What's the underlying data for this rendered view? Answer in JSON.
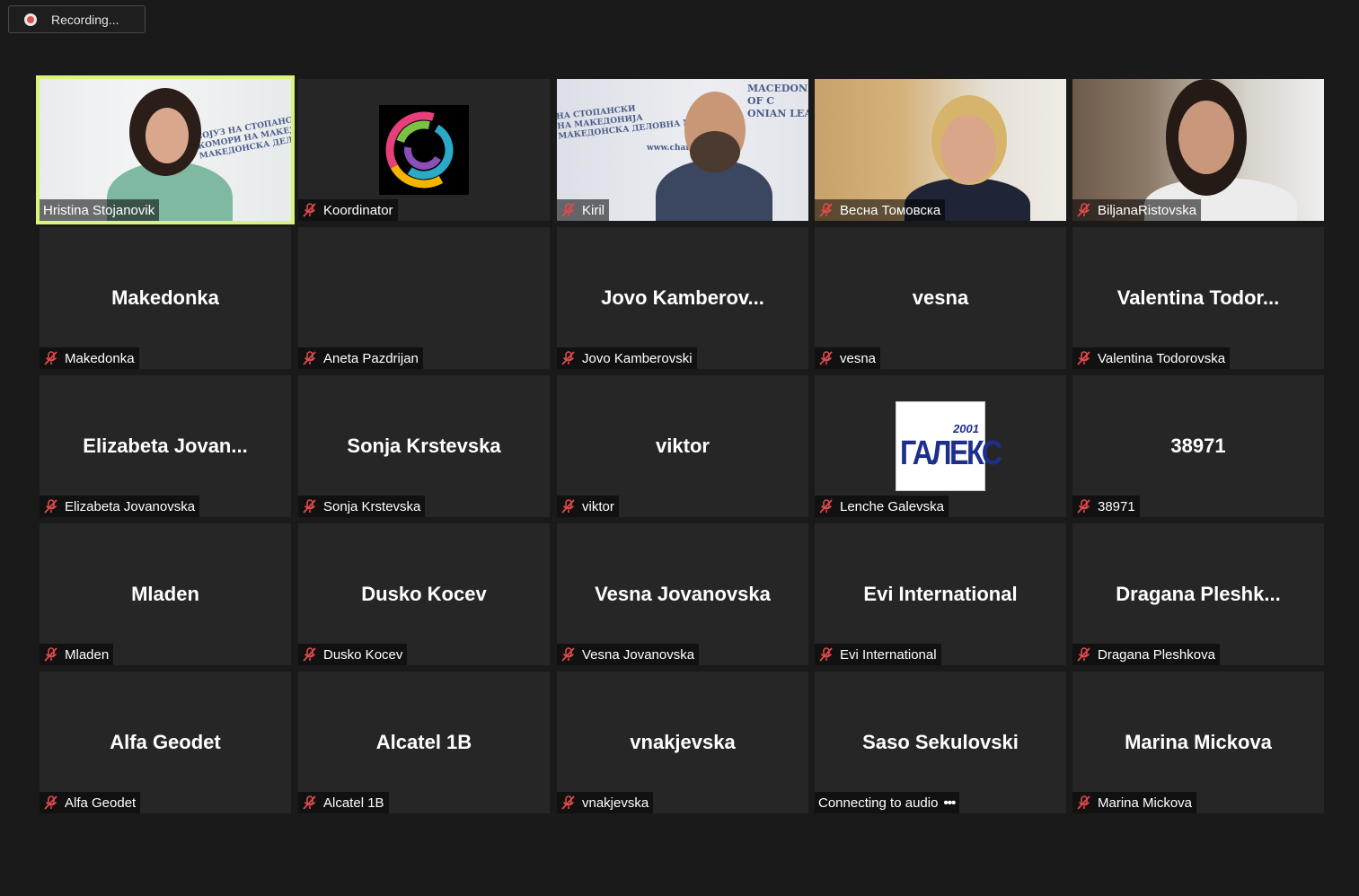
{
  "recording": {
    "label": "Recording..."
  },
  "participants": [
    {
      "label": "Hristina Stojanovik",
      "center": "",
      "muted": false,
      "video": "hristina",
      "active": true
    },
    {
      "label": "Koordinator",
      "center": "",
      "muted": true,
      "video": "logo"
    },
    {
      "label": "Kiril",
      "center": "",
      "muted": true,
      "video": "kiril"
    },
    {
      "label": "Весна Томовска",
      "center": "",
      "muted": true,
      "video": "vesna"
    },
    {
      "label": "BiljanaRistovska",
      "center": "",
      "muted": true,
      "video": "biljana"
    },
    {
      "label": "Makedonka",
      "center": "Makedonka",
      "muted": true
    },
    {
      "label": "Aneta Pazdrijan",
      "center": "",
      "muted": true
    },
    {
      "label": "Jovo Kamberovski",
      "center": "Jovo  Kamberov...",
      "muted": true
    },
    {
      "label": "vesna",
      "center": "vesna",
      "muted": true
    },
    {
      "label": "Valentina Todorovska",
      "center": "Valentina  Todor...",
      "muted": true
    },
    {
      "label": "Elizabeta Jovanovska",
      "center": "Elizabeta  Jovan...",
      "muted": true
    },
    {
      "label": "Sonja Krstevska",
      "center": "Sonja Krstevska",
      "muted": true
    },
    {
      "label": "viktor",
      "center": "viktor",
      "muted": true
    },
    {
      "label": "Lenche Galevska",
      "center": "",
      "muted": true,
      "video": "galex"
    },
    {
      "label": "38971",
      "center": "38971",
      "muted": true
    },
    {
      "label": "Mladen",
      "center": "Mladen",
      "muted": true
    },
    {
      "label": "Dusko Kocev",
      "center": "Dusko Kocev",
      "muted": true
    },
    {
      "label": "Vesna Jovanovska",
      "center": "Vesna Jovanovska",
      "muted": true
    },
    {
      "label": "Evi International",
      "center": "Evi International",
      "muted": true
    },
    {
      "label": "Dragana Pleshkova",
      "center": "Dragana  Pleshk...",
      "muted": true
    },
    {
      "label": "Alfa Geodet",
      "center": "Alfa Geodet",
      "muted": true
    },
    {
      "label": "Alcatel 1B",
      "center": "Alcatel 1B",
      "muted": true
    },
    {
      "label": "vnakjevska",
      "center": "vnakjevska",
      "muted": true
    },
    {
      "label": "Connecting to audio",
      "center": "Saso Sekulovski",
      "muted": false,
      "connecting": true
    },
    {
      "label": "Marina Mickova",
      "center": "Marina Mickova",
      "muted": true
    }
  ],
  "backdrop": {
    "hristina": "СОЈУЗ НА СТОПАНСКИ\nКОМОРИ НА МАКЕДОНИЈА\nМАКЕДОНСКА ДЕЛОВНА МРЕЖА",
    "kiril_left": "НА СТОПАНСКИ\nНА МАКЕДОНИЈА\nМАКЕДОНСКА ДЕЛОВНА МРЕЖА",
    "kiril_right": "MACEDONI\nOF C\nONIAN LEA",
    "kiril_url": "www.chan"
  },
  "galex": {
    "year": "2001",
    "text": "ГАЛЕКС"
  },
  "colors": {
    "active_border": "#d9f47a",
    "mute_red": "#e04a4a",
    "tile_bg": "#262626"
  }
}
